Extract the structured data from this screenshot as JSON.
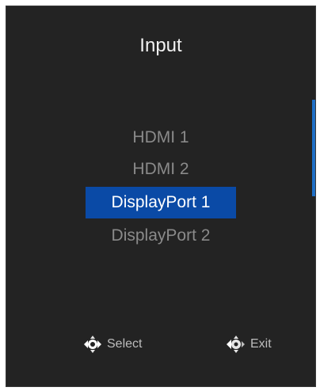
{
  "header": {
    "title": "Input"
  },
  "menu": {
    "items": [
      {
        "label": "HDMI 1"
      },
      {
        "label": "HDMI 2"
      },
      {
        "label": "DisplayPort 1"
      },
      {
        "label": "DisplayPort 2"
      }
    ],
    "selected": "DisplayPort 1"
  },
  "footer": {
    "select_label": "Select",
    "exit_label": "Exit",
    "select_icon": "joystick-press-icon",
    "exit_icon": "joystick-left-icon"
  },
  "colors": {
    "panel_background": "#232323",
    "highlight": "#0a4aa6",
    "scrollbar": "#1f6fc6",
    "unselected_text": "#8a8a8a"
  }
}
